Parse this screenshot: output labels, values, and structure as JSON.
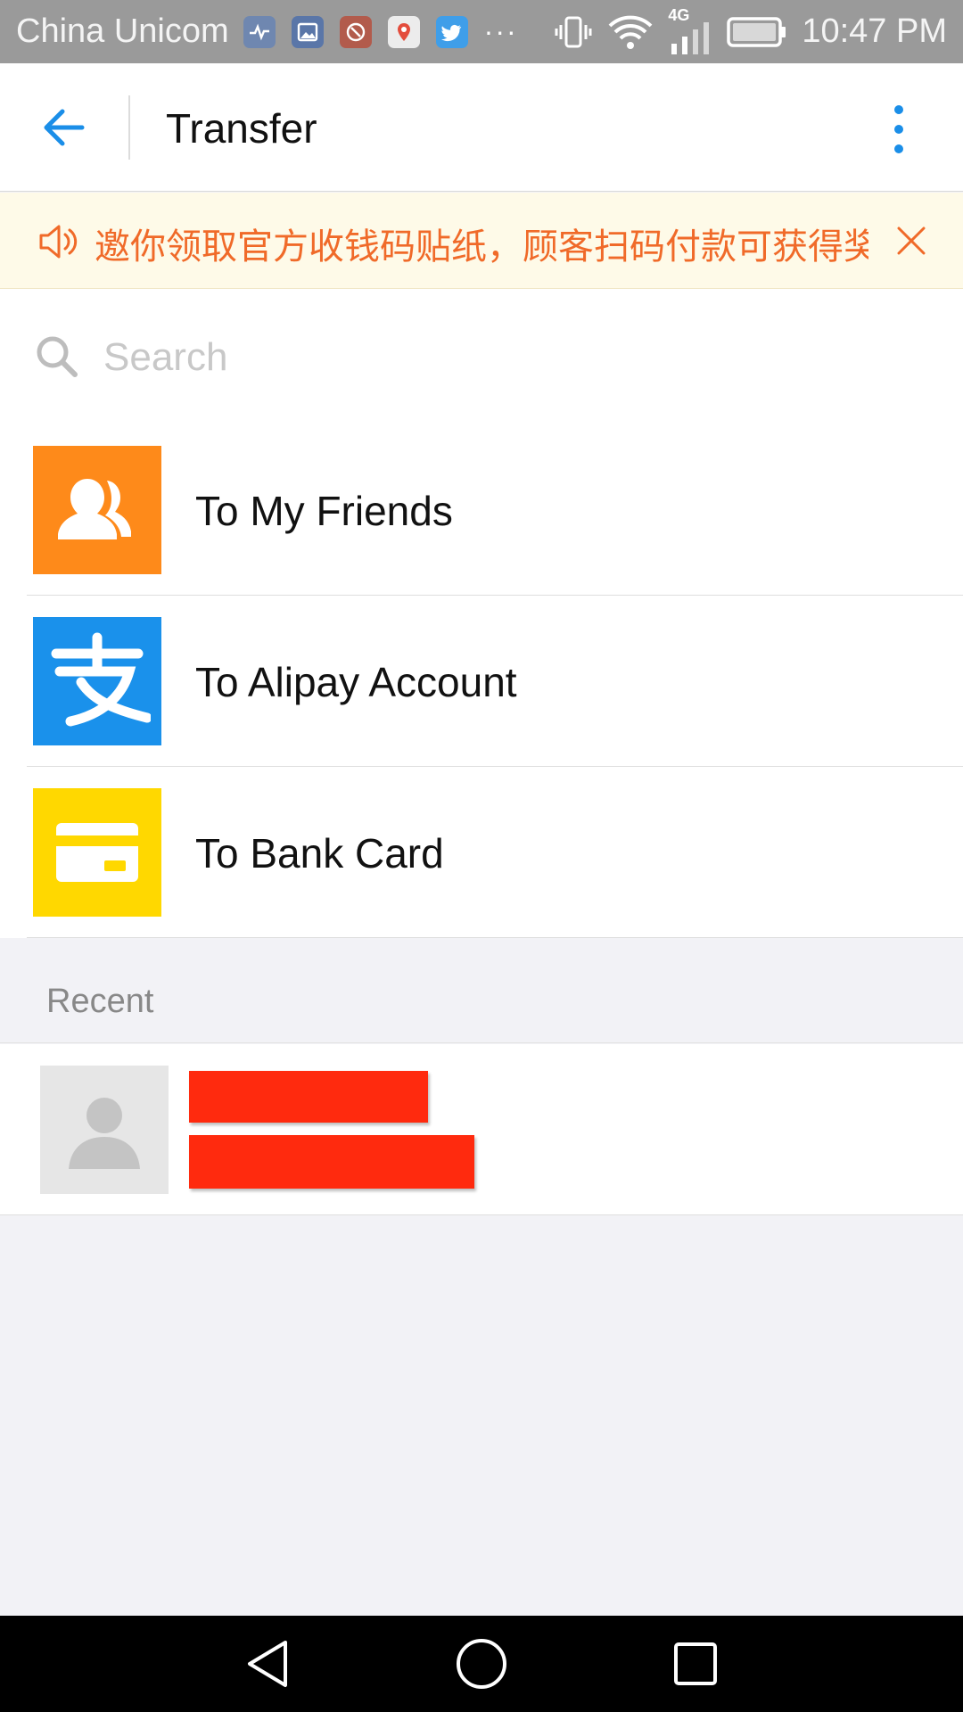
{
  "status_bar": {
    "carrier": "China Unicom",
    "time": "10:47 PM",
    "network": "4G",
    "overflow": "···",
    "notification_icons": [
      "health-icon",
      "gallery-icon",
      "app-icon",
      "maps-icon",
      "twitter-icon"
    ]
  },
  "app_bar": {
    "title": "Transfer"
  },
  "notice": {
    "text": "邀你领取官方收钱码贴纸，顾客扫码付款可获得奖励",
    "color": "#f06a29"
  },
  "search": {
    "placeholder": "Search"
  },
  "options": [
    {
      "label": "To My Friends",
      "icon": "friends-icon",
      "color": "#fe8a1a"
    },
    {
      "label": "To Alipay Account",
      "icon": "alipay-icon",
      "color": "#1a91eb"
    },
    {
      "label": "To Bank Card",
      "icon": "bank-card-icon",
      "color": "#ffd800"
    }
  ],
  "recent": {
    "header": "Recent",
    "items": [
      {
        "avatar": "default-avatar-icon",
        "redacted": true
      }
    ]
  },
  "colors": {
    "accent": "#1a8ee8",
    "redaction": "#ff2a0e"
  }
}
